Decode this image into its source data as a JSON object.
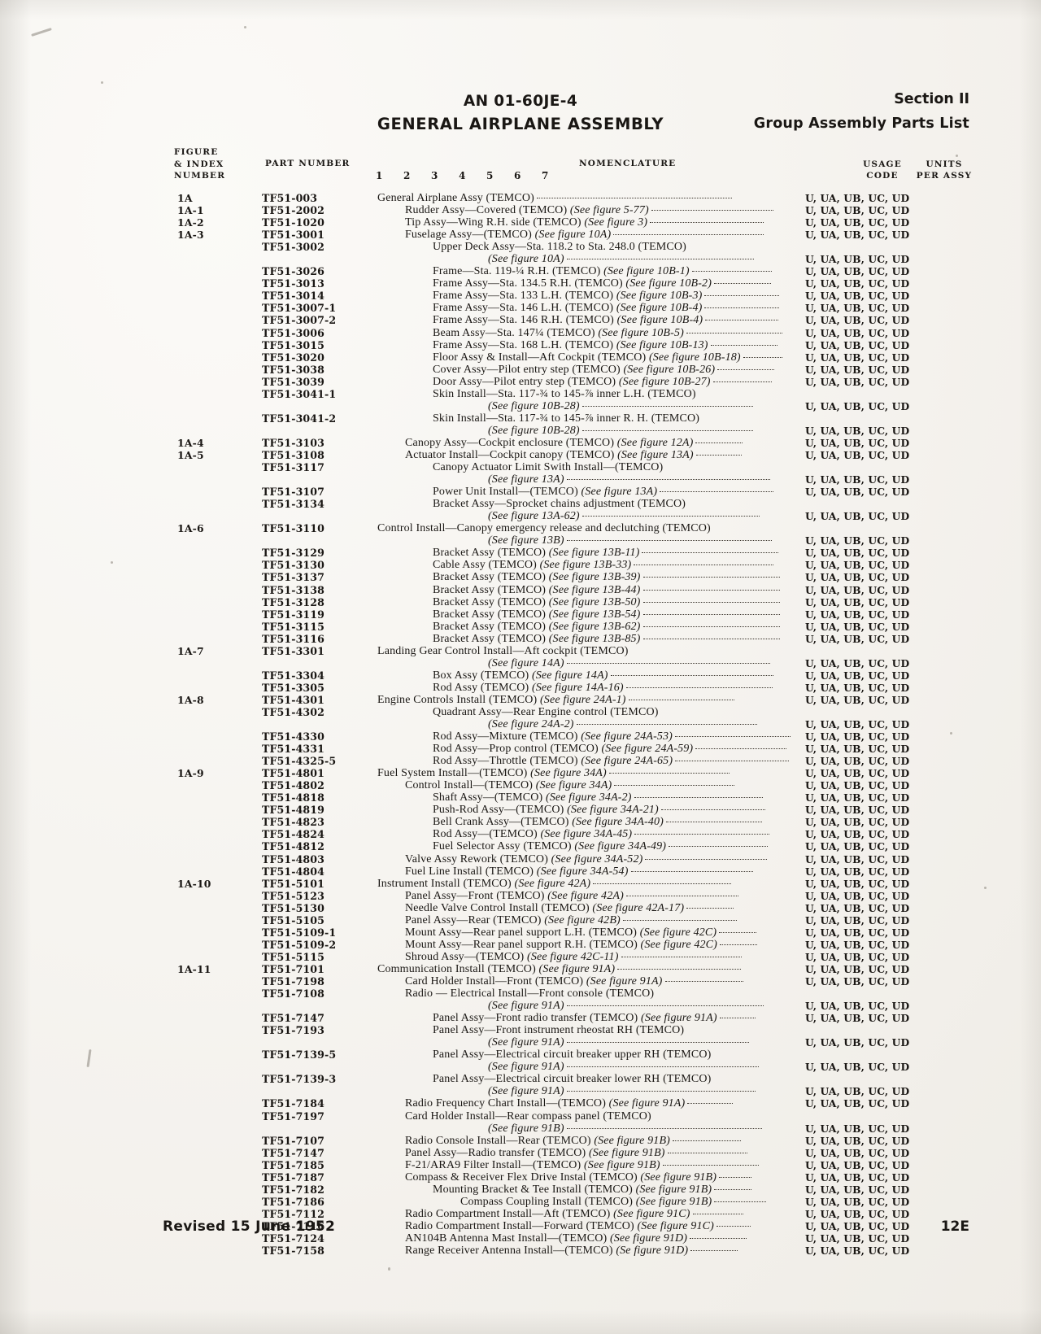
{
  "header": {
    "doc_number": "AN 01-60JE-4",
    "doc_title": "GENERAL AIRPLANE ASSEMBLY",
    "section": "Section II",
    "section_sub": "Group Assembly Parts List"
  },
  "columns": {
    "figure_index_number": "FIGURE\n& INDEX\nNUMBER",
    "figure_line1": "FIGURE",
    "figure_line2": "& INDEX",
    "figure_line3": "NUMBER",
    "part_number": "PART NUMBER",
    "nomenclature": "NOMENCLATURE",
    "usage_line1": "USAGE",
    "usage_line2": "CODE",
    "units_line1": "UNITS",
    "units_line2": "PER ASSY",
    "indent_digits": [
      "1",
      "2",
      "3",
      "4",
      "5",
      "6",
      "7"
    ]
  },
  "usage_code_default": "U, UA, UB, UC, UD",
  "rows": [
    {
      "index": "1A",
      "part": "TF51-003",
      "level": 1,
      "nom": "General Airplane Assy (TEMCO)",
      "note": "",
      "leader": 240,
      "usage": "U, UA, UB, UC, UD"
    },
    {
      "index": "1A-1",
      "part": "TF51-2002",
      "level": 2,
      "nom": "Rudder Assy—Covered (TEMCO) ",
      "note": "(See figure 5-77)",
      "leader": 150,
      "usage": "U, UA, UB, UC, UD"
    },
    {
      "index": "1A-2",
      "part": "TF51-1020",
      "level": 2,
      "nom": "Tip Assy—Wing R.H. side (TEMCO) ",
      "note": "(See figure 3)",
      "leader": 140,
      "usage": "U, UA, UB, UC, UD"
    },
    {
      "index": "1A-3",
      "part": "TF51-3001",
      "level": 2,
      "nom": "Fuselage Assy—(TEMCO) ",
      "note": "(See figure 10A)",
      "leader": 185,
      "usage": "U, UA, UB, UC, UD"
    },
    {
      "index": "",
      "part": "TF51-3002",
      "level": 3,
      "nom": "Upper Deck Assy—Sta. 118.2 to Sta. 248.0 (TEMCO)",
      "note": "",
      "leader": 0,
      "usage": ""
    },
    {
      "index": "",
      "part": "",
      "level": 5,
      "nom": "",
      "note": "(See figure 10A)",
      "leader": 230,
      "usage": "U, UA, UB, UC, UD"
    },
    {
      "index": "",
      "part": "TF51-3026",
      "level": 3,
      "nom": "Frame—Sta. 119-¼ R.H. (TEMCO) ",
      "note": "(See figure 10B-1)",
      "leader": 98,
      "usage": "U, UA, UB, UC, UD"
    },
    {
      "index": "",
      "part": "TF51-3013",
      "level": 3,
      "nom": "Frame Assy—Sta. 134.5 R.H. (TEMCO) ",
      "note": "(See figure 10B-2)",
      "leader": 70,
      "usage": "U, UA, UB, UC, UD"
    },
    {
      "index": "",
      "part": "TF51-3014",
      "level": 3,
      "nom": "Frame Assy—Sta. 133 L.H. (TEMCO) ",
      "note": "(See figure 10B-3)",
      "leader": 92,
      "usage": "U, UA, UB, UC, UD"
    },
    {
      "index": "",
      "part": "TF51-3007-1",
      "level": 3,
      "nom": "Frame Assy—Sta. 146 L.H. (TEMCO) ",
      "note": "(See figure 10B-4)",
      "leader": 92,
      "usage": "U, UA, UB, UC, UD"
    },
    {
      "index": "",
      "part": "TF51-3007-2",
      "level": 3,
      "nom": "Frame Assy—Sta. 146 R.H. (TEMCO) ",
      "note": "(See figure 10B-4)",
      "leader": 90,
      "usage": "U, UA, UB, UC, UD"
    },
    {
      "index": "",
      "part": "TF51-3006",
      "level": 3,
      "nom": "Beam Assy—Sta. 147¼ (TEMCO) ",
      "note": "(See figure 10B-5)",
      "leader": 118,
      "usage": "U, UA, UB, UC, UD"
    },
    {
      "index": "",
      "part": "TF51-3015",
      "level": 3,
      "nom": "Frame Assy—Sta. 168 L.H. (TEMCO) ",
      "note": "(See figure 10B-13)",
      "leader": 82,
      "usage": "U, UA, UB, UC, UD"
    },
    {
      "index": "",
      "part": "TF51-3020",
      "level": 3,
      "nom": "Floor Assy & Install—Aft Cockpit (TEMCO) ",
      "note": "(See figure 10B-18)",
      "leader": 48,
      "usage": "U, UA, UB, UC, UD"
    },
    {
      "index": "",
      "part": "TF51-3038",
      "level": 3,
      "nom": "Cover Assy—Pilot entry step (TEMCO) ",
      "note": "(See figure 10B-26)",
      "leader": 70,
      "usage": "U, UA, UB, UC, UD"
    },
    {
      "index": "",
      "part": "TF51-3039",
      "level": 3,
      "nom": "Door Assy—Pilot entry step (TEMCO) ",
      "note": "(See figure 10B-27)",
      "leader": 72,
      "usage": "U, UA, UB, UC, UD"
    },
    {
      "index": "",
      "part": "TF51-3041-1",
      "level": 3,
      "nom": "Skin Install—Sta. 117-¾ to 145-⅞ inner L.H. (TEMCO)",
      "note": "",
      "leader": 0,
      "usage": ""
    },
    {
      "index": "",
      "part": "",
      "level": 5,
      "nom": "",
      "note": "(See figure 10B-28)",
      "leader": 210,
      "usage": "U, UA, UB, UC, UD"
    },
    {
      "index": "",
      "part": "TF51-3041-2",
      "level": 3,
      "nom": "Skin Install—Sta. 117-¾ to 145-⅞ inner R. H. (TEMCO)",
      "note": "",
      "leader": 0,
      "usage": ""
    },
    {
      "index": "",
      "part": "",
      "level": 5,
      "nom": "",
      "note": "(See figure 10B-28)",
      "leader": 210,
      "usage": "U, UA, UB, UC, UD"
    },
    {
      "index": "1A-4",
      "part": "TF51-3103",
      "level": 2,
      "nom": "Canopy Assy—Cockpit enclosure (TEMCO) ",
      "note": "(See figure 12A)",
      "leader": 58,
      "usage": "U, UA, UB, UC, UD"
    },
    {
      "index": "1A-5",
      "part": "TF51-3108",
      "level": 2,
      "nom": "Actuator Install—Cockpit canopy (TEMCO) ",
      "note": "(See figure 13A)",
      "leader": 56,
      "usage": "U, UA, UB, UC, UD"
    },
    {
      "index": "",
      "part": "TF51-3117",
      "level": 3,
      "nom": "Canopy Actuator Limit Swith Install—(TEMCO)",
      "note": "",
      "leader": 0,
      "usage": ""
    },
    {
      "index": "",
      "part": "",
      "level": 5,
      "nom": "",
      "note": "(See figure 13A)",
      "leader": 250,
      "usage": "U, UA, UB, UC, UD"
    },
    {
      "index": "",
      "part": "TF51-3107",
      "level": 3,
      "nom": "Power Unit Install—(TEMCO) ",
      "note": "(See figure 13A)",
      "leader": 140,
      "usage": "U, UA, UB, UC, UD"
    },
    {
      "index": "",
      "part": "TF51-3134",
      "level": 3,
      "nom": "Bracket Assy—Sprocket chains adjustment (TEMCO)",
      "note": "",
      "leader": 0,
      "usage": ""
    },
    {
      "index": "",
      "part": "",
      "level": 5,
      "nom": "",
      "note": "(See figure 13A-62)",
      "leader": 218,
      "usage": "U, UA, UB, UC, UD"
    },
    {
      "index": "1A-6",
      "part": "TF51-3110",
      "level": 1,
      "nom": "Control Install—Canopy emergency release and declutching (TEMCO)",
      "note": "",
      "leader": 0,
      "usage": ""
    },
    {
      "index": "",
      "part": "",
      "level": 5,
      "nom": "",
      "note": "(See figure 13B)",
      "leader": 252,
      "usage": "U, UA, UB, UC, UD"
    },
    {
      "index": "",
      "part": "TF51-3129",
      "level": 3,
      "nom": "Bracket Assy (TEMCO) ",
      "note": "(See figure 13B-11)",
      "leader": 168,
      "usage": "U, UA, UB, UC, UD"
    },
    {
      "index": "",
      "part": "TF51-3130",
      "level": 3,
      "nom": "Cable Assy (TEMCO) ",
      "note": "(See figure 13B-33)",
      "leader": 172,
      "usage": "U, UA, UB, UC, UD"
    },
    {
      "index": "",
      "part": "TF51-3137",
      "level": 3,
      "nom": "Bracket Assy (TEMCO) ",
      "note": "(See figure 13B-39)",
      "leader": 168,
      "usage": "U, UA, UB, UC, UD"
    },
    {
      "index": "",
      "part": "TF51-3138",
      "level": 3,
      "nom": "Bracket Assy (TEMCO) ",
      "note": "(See figure 13B-44)",
      "leader": 168,
      "usage": "U, UA, UB, UC, UD"
    },
    {
      "index": "",
      "part": "TF51-3128",
      "level": 3,
      "nom": "Bracket Assy (TEMCO) ",
      "note": "(See figure 13B-50)",
      "leader": 168,
      "usage": "U, UA, UB, UC, UD"
    },
    {
      "index": "",
      "part": "TF51-3119",
      "level": 3,
      "nom": "Bracket Assy (TEMCO) ",
      "note": "(See figure 13B-54)",
      "leader": 168,
      "usage": "U, UA, UB, UC, UD"
    },
    {
      "index": "",
      "part": "TF51-3115",
      "level": 3,
      "nom": "Bracket Assy (TEMCO) ",
      "note": "(See figure 13B-62)",
      "leader": 168,
      "usage": "U, UA, UB, UC, UD"
    },
    {
      "index": "",
      "part": "TF51-3116",
      "level": 3,
      "nom": "Bracket Assy (TEMCO) ",
      "note": "(See figure 13B-85)",
      "leader": 168,
      "usage": "U, UA, UB, UC, UD"
    },
    {
      "index": "1A-7",
      "part": "TF51-3301",
      "level": 1,
      "nom": "Landing Gear Control Install—Aft cockpit (TEMCO)",
      "note": "",
      "leader": 0,
      "usage": ""
    },
    {
      "index": "",
      "part": "",
      "level": 5,
      "nom": "",
      "note": "(See figure 14A)",
      "leader": 250,
      "usage": "U, UA, UB, UC, UD"
    },
    {
      "index": "",
      "part": "TF51-3304",
      "level": 3,
      "nom": "Box Assy (TEMCO) ",
      "note": "(See figure 14A)",
      "leader": 200,
      "usage": "U, UA, UB, UC, UD"
    },
    {
      "index": "",
      "part": "TF51-3305",
      "level": 3,
      "nom": "Rod Assy (TEMCO) ",
      "note": "(See figure 14A-16)",
      "leader": 180,
      "usage": "U, UA, UB, UC, UD"
    },
    {
      "index": "1A-8",
      "part": "TF51-4301",
      "level": 1,
      "nom": "Engine Controls Install (TEMCO) ",
      "note": "(See figure 24A-1)",
      "leader": 130,
      "usage": "U, UA, UB, UC, UD"
    },
    {
      "index": "",
      "part": "TF51-4302",
      "level": 3,
      "nom": "Quadrant Assy—Rear Engine control (TEMCO)",
      "note": "",
      "leader": 0,
      "usage": ""
    },
    {
      "index": "",
      "part": "",
      "level": 5,
      "nom": "",
      "note": "(See figure 24A-2)",
      "leader": 222,
      "usage": "U, UA, UB, UC, UD"
    },
    {
      "index": "",
      "part": "TF51-4330",
      "level": 3,
      "nom": "Rod Assy—Mixture (TEMCO) ",
      "note": "(See figure 24A-53)",
      "leader": 142,
      "usage": "U, UA, UB, UC, UD"
    },
    {
      "index": "",
      "part": "TF51-4331",
      "level": 3,
      "nom": "Rod Assy—Prop control (TEMCO) ",
      "note": "(See figure 24A-59)",
      "leader": 112,
      "usage": "U, UA, UB, UC, UD"
    },
    {
      "index": "",
      "part": "TF51-4325-5",
      "level": 3,
      "nom": "Rod Assy—Throttle (TEMCO) ",
      "note": "(See figure 24A-65)",
      "leader": 140,
      "usage": "U, UA, UB, UC, UD"
    },
    {
      "index": "1A-9",
      "part": "TF51-4801",
      "level": 1,
      "nom": "Fuel System Install—(TEMCO) ",
      "note": "(See figure 34A)",
      "leader": 148,
      "usage": "U, UA, UB, UC, UD"
    },
    {
      "index": "",
      "part": "TF51-4802",
      "level": 2,
      "nom": "Control Install—(TEMCO) ",
      "note": "(See figure 34A)",
      "leader": 148,
      "usage": "U, UA, UB, UC, UD"
    },
    {
      "index": "",
      "part": "TF51-4818",
      "level": 3,
      "nom": "Shaft Assy—(TEMCO) ",
      "note": "(See figure 34A-2)",
      "leader": 158,
      "usage": "U, UA, UB, UC, UD"
    },
    {
      "index": "",
      "part": "TF51-4819",
      "level": 3,
      "nom": "Push-Rod Assy—(TEMCO) ",
      "note": "(See figure 34A-21)",
      "leader": 128,
      "usage": "U, UA, UB, UC, UD"
    },
    {
      "index": "",
      "part": "TF51-4823",
      "level": 3,
      "nom": "Bell Crank Assy—(TEMCO) ",
      "note": "(See figure 34A-40)",
      "leader": 118,
      "usage": "U, UA, UB, UC, UD"
    },
    {
      "index": "",
      "part": "TF51-4824",
      "level": 3,
      "nom": "Rod Assy—(TEMCO) ",
      "note": "(See figure 34A-45)",
      "leader": 166,
      "usage": "U, UA, UB, UC, UD"
    },
    {
      "index": "",
      "part": "TF51-4812",
      "level": 3,
      "nom": "Fuel Selector Assy (TEMCO) ",
      "note": "(See figure 34A-49)",
      "leader": 122,
      "usage": "U, UA, UB, UC, UD"
    },
    {
      "index": "",
      "part": "TF51-4803",
      "level": 2,
      "nom": "Valve Assy Rework (TEMCO) ",
      "note": "(See figure 34A-52)",
      "leader": 150,
      "usage": "U, UA, UB, UC, UD"
    },
    {
      "index": "",
      "part": "TF51-4804",
      "level": 2,
      "nom": "Fuel Line Install (TEMCO) ",
      "note": "(See figure 34A-54)",
      "leader": 150,
      "usage": "U, UA, UB, UC, UD"
    },
    {
      "index": "1A-10",
      "part": "TF51-5101",
      "level": 1,
      "nom": "Instrument Install (TEMCO) ",
      "note": "(See figure 42A)",
      "leader": 170,
      "usage": "U, UA, UB, UC, UD"
    },
    {
      "index": "",
      "part": "TF51-5123",
      "level": 2,
      "nom": "Panel Assy—Front (TEMCO) ",
      "note": "(See figure 42A)",
      "leader": 138,
      "usage": "U, UA, UB, UC, UD"
    },
    {
      "index": "",
      "part": "TF51-5130",
      "level": 2,
      "nom": "Needle Valve Control Install (TEMCO) ",
      "note": "(See figure 42A-17)",
      "leader": 58,
      "usage": "U, UA, UB, UC, UD"
    },
    {
      "index": "",
      "part": "TF51-5105",
      "level": 2,
      "nom": "Panel Assy—Rear (TEMCO) ",
      "note": "(See figure 42B)",
      "leader": 140,
      "usage": "U, UA, UB, UC, UD"
    },
    {
      "index": "",
      "part": "TF51-5109-1",
      "level": 2,
      "nom": "Mount Assy—Rear panel support L.H. (TEMCO) ",
      "note": "(See figure 42C)",
      "leader": 46,
      "usage": "U, UA, UB, UC, UD"
    },
    {
      "index": "",
      "part": "TF51-5109-2",
      "level": 2,
      "nom": "Mount Assy—Rear panel support R.H. (TEMCO) ",
      "note": "(See figure 42C)",
      "leader": 46,
      "usage": "U, UA, UB, UC, UD"
    },
    {
      "index": "",
      "part": "TF51-5115",
      "level": 2,
      "nom": "Shroud Assy—(TEMCO) ",
      "note": "(See figure 42C-11)",
      "leader": 148,
      "usage": "U, UA, UB, UC, UD"
    },
    {
      "index": "1A-11",
      "part": "TF51-7101",
      "level": 1,
      "nom": "Communication Install (TEMCO) ",
      "note": "(See figure 91A)",
      "leader": 152,
      "usage": "U, UA, UB, UC, UD"
    },
    {
      "index": "",
      "part": "TF51-7198",
      "level": 2,
      "nom": "Card Holder Install—Front (TEMCO) ",
      "note": "(See figure 91A)",
      "leader": 96,
      "usage": "U, UA, UB, UC, UD"
    },
    {
      "index": "",
      "part": "TF51-7108",
      "level": 2,
      "nom": "Radio — Electrical Install—Front console (TEMCO)",
      "note": "",
      "leader": 0,
      "usage": ""
    },
    {
      "index": "",
      "part": "",
      "level": 5,
      "nom": "",
      "note": "(See figure 91A)",
      "leader": 242,
      "usage": "U, UA, UB, UC, UD"
    },
    {
      "index": "",
      "part": "TF51-7147",
      "level": 3,
      "nom": "Panel Assy—Front radio transfer (TEMCO) ",
      "note": "(See figure 91A)",
      "leader": 44,
      "usage": "U, UA, UB, UC, UD"
    },
    {
      "index": "",
      "part": "TF51-7193",
      "level": 3,
      "nom": "Panel Assy—Front instrument rheostat RH (TEMCO)",
      "note": "",
      "leader": 0,
      "usage": ""
    },
    {
      "index": "",
      "part": "",
      "level": 5,
      "nom": "",
      "note": "(See figure 91A)",
      "leader": 224,
      "usage": "U, UA, UB, UC, UD"
    },
    {
      "index": "",
      "part": "TF51-7139-5",
      "level": 3,
      "nom": "Panel Assy—Electrical circuit breaker upper RH (TEMCO)",
      "note": "",
      "leader": 0,
      "usage": ""
    },
    {
      "index": "",
      "part": "",
      "level": 5,
      "nom": "",
      "note": "(See figure 91A)",
      "leader": 236,
      "usage": "U, UA, UB, UC, UD"
    },
    {
      "index": "",
      "part": "TF51-7139-3",
      "level": 3,
      "nom": "Panel Assy—Electrical circuit breaker lower RH (TEMCO)",
      "note": "",
      "leader": 0,
      "usage": ""
    },
    {
      "index": "",
      "part": "",
      "level": 5,
      "nom": "",
      "note": "(See figure 91A)",
      "leader": 232,
      "usage": "U, UA, UB, UC, UD"
    },
    {
      "index": "",
      "part": "TF51-7184",
      "level": 2,
      "nom": "Radio Frequency Chart Install—(TEMCO) ",
      "note": "(See figure 91A)",
      "leader": 56,
      "usage": "U, UA, UB, UC, UD"
    },
    {
      "index": "",
      "part": "TF51-7197",
      "level": 2,
      "nom": "Card Holder Install—Rear compass panel (TEMCO)",
      "note": "",
      "leader": 0,
      "usage": ""
    },
    {
      "index": "",
      "part": "",
      "level": 5,
      "nom": "",
      "note": "(See figure 91B)",
      "leader": 240,
      "usage": "U, UA, UB, UC, UD"
    },
    {
      "index": "",
      "part": "TF51-7107",
      "level": 2,
      "nom": "Radio Console Install—Rear (TEMCO) ",
      "note": "(See figure 91B)",
      "leader": 84,
      "usage": "U, UA, UB, UC, UD"
    },
    {
      "index": "",
      "part": "TF51-7147",
      "level": 2,
      "nom": "Panel Assy—Radio transfer (TEMCO) ",
      "note": "(See figure 91B)",
      "leader": 98,
      "usage": "U, UA, UB, UC, UD"
    },
    {
      "index": "",
      "part": "TF51-7185",
      "level": 2,
      "nom": "F-21/ARA9 Filter Install—(TEMCO) ",
      "note": "(See figure 91B)",
      "leader": 118,
      "usage": "U, UA, UB, UC, UD"
    },
    {
      "index": "",
      "part": "TF51-7187",
      "level": 2,
      "nom": "Compass & Receiver Flex Drive Instal (TEMCO) ",
      "note": "(See figure 91B)",
      "leader": 40,
      "usage": "U, UA, UB, UC, UD"
    },
    {
      "index": "",
      "part": "TF51-7182",
      "level": 3,
      "nom": "Mounting Bracket & Tee Install (TEMCO) ",
      "note": "(See figure 91B)",
      "leader": 46,
      "usage": "U, UA, UB, UC, UD"
    },
    {
      "index": "",
      "part": "TF51-7186",
      "level": 4,
      "nom": "Compass Coupling Install (TEMCO) ",
      "note": "(See figure 91B)",
      "leader": 64,
      "usage": "U, UA, UB, UC, UD"
    },
    {
      "index": "",
      "part": "TF51-7112",
      "level": 2,
      "nom": "Radio Compartment Install—Aft (TEMCO) ",
      "note": "(See figure 91C)",
      "leader": 62,
      "usage": "U, UA, UB, UC, UD"
    },
    {
      "index": "",
      "part": "TF51-7116",
      "level": 2,
      "nom": "Radio Compartment Install—Forward (TEMCO) ",
      "note": "(See figure 91C)",
      "leader": 42,
      "usage": "U, UA, UB, UC, UD"
    },
    {
      "index": "",
      "part": "TF51-7124",
      "level": 2,
      "nom": "AN104B Antenna Mast Install—(TEMCO) ",
      "note": "(See figure 91D)",
      "leader": 70,
      "usage": "U, UA, UB, UC, UD"
    },
    {
      "index": "",
      "part": "TF51-7158",
      "level": 2,
      "nom": "Range Receiver Antenna Install—(TEMCO) ",
      "note": "(Se figure 91D)",
      "leader": 58,
      "usage": "U, UA, UB, UC, UD"
    }
  ],
  "footer": {
    "revised": "Revised 15 June 1952",
    "page_number": "12E"
  }
}
